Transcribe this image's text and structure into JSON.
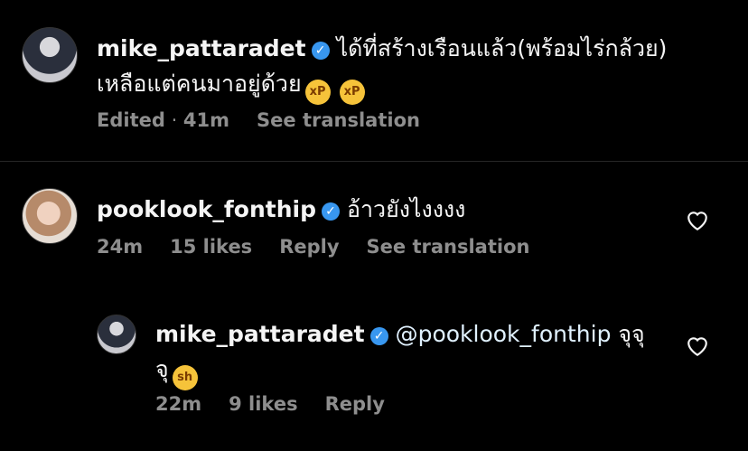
{
  "comments": [
    {
      "username": "mike_pattaradet",
      "verified": true,
      "text_line1": "ได้ที่สร้างเรือนแล้ว(พร้อมไร่กล้วย)",
      "text_line2": "เหลือแต่คนมาอยู่ด้วย",
      "emoji1": "squinting-tongue-emoji",
      "emoji2": "squinting-tongue-emoji",
      "edited": "Edited",
      "time": "41m",
      "translation": "See translation"
    },
    {
      "username": "pooklook_fonthip",
      "verified": true,
      "text": "อ้าวยังไงงงง",
      "time": "24m",
      "likes": "15 likes",
      "reply": "Reply",
      "translation": "See translation"
    }
  ],
  "reply": {
    "username": "mike_pattaradet",
    "verified": true,
    "mention": "@pooklook_fonthip",
    "text_line1_suffix": "จุจุ",
    "text_line2": "จุ",
    "emoji": "shushing-face-emoji",
    "time": "22m",
    "likes": "9 likes",
    "reply": "Reply"
  },
  "colors": {
    "background": "#000000",
    "text": "#f5f5f5",
    "meta": "#8e8e8e",
    "verified": "#3897f0",
    "mention": "#e0f1ff"
  }
}
